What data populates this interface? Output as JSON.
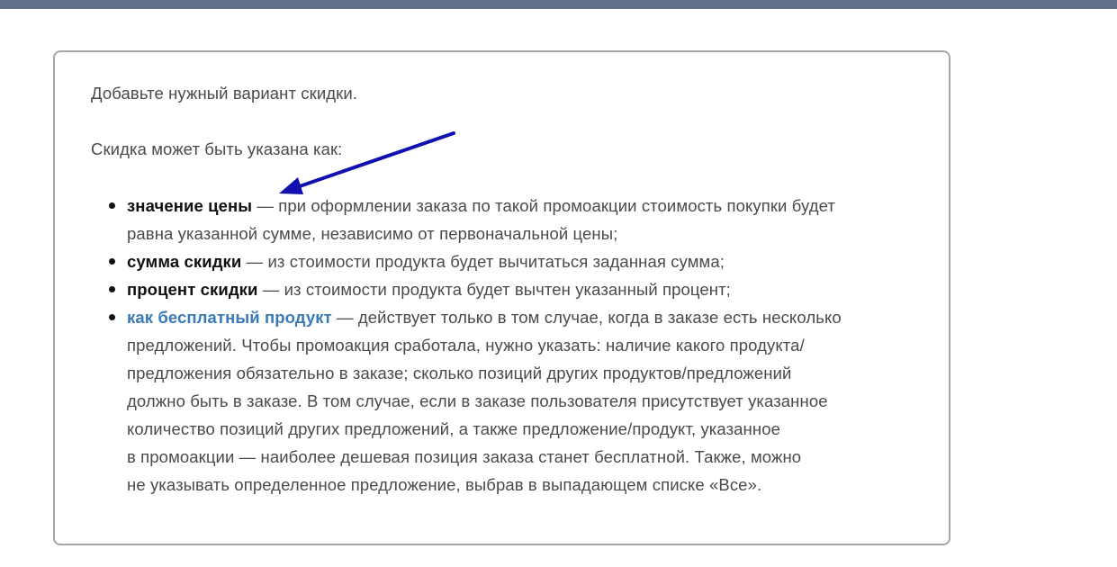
{
  "page": {
    "intro": "Добавьте нужный вариант скидки.",
    "kinds_heading": "Скидка может быть указана как:"
  },
  "list": {
    "items": [
      {
        "term": "значение цены",
        "lines": [
          " — при оформлении заказа по такой промоакции стоимость покупки будет",
          "равна указанной сумме, независимо от первоначальной цены;"
        ]
      },
      {
        "term": "сумма скидки",
        "lines": [
          " — из стоимости продукта будет вычитаться заданная сумма;"
        ]
      },
      {
        "term": "процент скидки",
        "lines": [
          " — из стоимости продукта будет вычтен указанный процент;"
        ]
      },
      {
        "term": "как бесплатный продукт",
        "lines": [
          " — действует только в том случае, когда в заказе есть несколько",
          "предложений. Чтобы промоакция сработала, нужно указать: наличие какого продукта/",
          "предложения обязательно в заказе; сколько позиций других продуктов/предложений",
          "должно быть в заказе. В том случае, если в заказе пользователя присутствует указанное",
          "количество позиций других предложений, а также предложение/продукт, указанное",
          "в промоакции — наиболее дешевая позиция заказа станет бесплатной. Также, можно",
          "не указывать определенное предложение, выбрав в выпадающем списке «Все»."
        ]
      }
    ]
  },
  "colors": {
    "top_bar": "#607088",
    "link": "#3a7ab8",
    "arrow": "#1010b0",
    "card_border": "#a6a6a6"
  },
  "annotation": {
    "icon": "arrow-annotation-icon"
  }
}
